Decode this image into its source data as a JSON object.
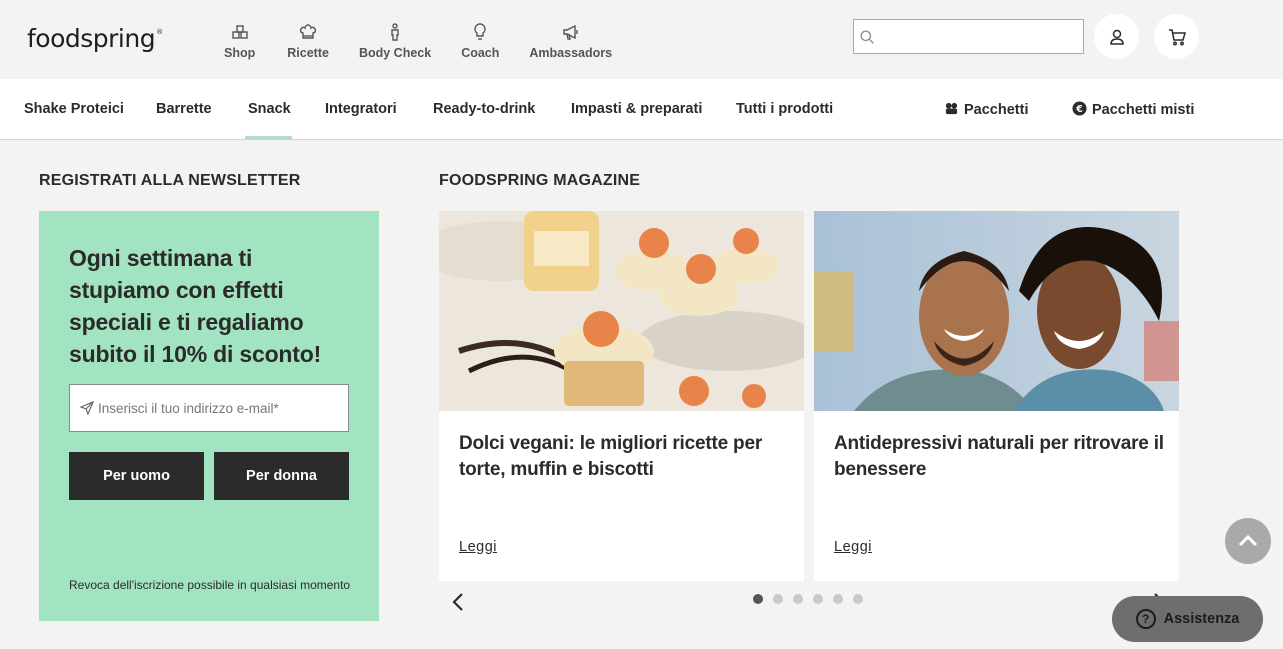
{
  "header": {
    "logo": "foodspring",
    "logo_mark": "®",
    "nav": [
      {
        "label": "Shop",
        "icon": "shop-icon"
      },
      {
        "label": "Ricette",
        "icon": "chef-hat-icon"
      },
      {
        "label": "Body Check",
        "icon": "body-icon"
      },
      {
        "label": "Coach",
        "icon": "lightbulb-icon"
      },
      {
        "label": "Ambassadors",
        "icon": "megaphone-icon"
      }
    ],
    "search": {
      "placeholder": "",
      "value": ""
    },
    "account_icon": "user-icon",
    "cart_icon": "cart-icon"
  },
  "categories": {
    "items": [
      "Shake Proteici",
      "Barrette",
      "Snack",
      "Integratori",
      "Ready-to-drink",
      "Impasti & preparati",
      "Tutti i prodotti"
    ],
    "active": "Snack",
    "bundles": "Pacchetti",
    "mixed_bundles": "Pacchetti misti"
  },
  "newsletter": {
    "heading": "REGISTRATI ALLA NEWSLETTER",
    "title": "Ogni settimana ti stupiamo con effetti speciali e ti regaliamo subito il 10% di sconto!",
    "email_placeholder": "Inserisci il tuo indirizzo e-mail*",
    "button_men": "Per uomo",
    "button_women": "Per donna",
    "note": "Revoca dell'iscrizione possibile in qualsiasi momento",
    "bg_color": "#a2e4c2"
  },
  "magazine": {
    "heading": "FOODSPRING MAGAZINE",
    "cards": [
      {
        "title": "Dolci vegani: le migliori ricette per torte, muffin e biscotti",
        "link": "Leggi"
      },
      {
        "title": "Antidepressivi naturali per ritrovare il benessere",
        "link": "Leggi"
      }
    ],
    "dots": 6,
    "active_dot": 1
  },
  "help": {
    "label": "Assistenza",
    "icon": "?"
  }
}
